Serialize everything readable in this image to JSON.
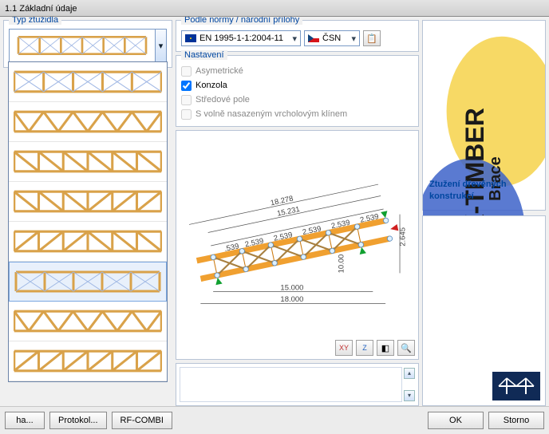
{
  "window": {
    "title": "1.1 Základní údaje"
  },
  "left": {
    "label": "Typ ztužidla"
  },
  "norm": {
    "label": "Podle normy / národní přílohy",
    "standard": "EN 1995-1-1:2004-11",
    "annex": "ČSN"
  },
  "settings": {
    "label": "Nastavení",
    "items": [
      {
        "label": "Asymetrické",
        "checked": false,
        "enabled": false
      },
      {
        "label": "Konzola",
        "checked": true,
        "enabled": true
      },
      {
        "label": "Středové pole",
        "checked": false,
        "enabled": false
      },
      {
        "label": "S volně nasazeným vrcholovým klínem",
        "checked": false,
        "enabled": false
      }
    ]
  },
  "diagram": {
    "dims": {
      "total_top": "18.278",
      "inner_top": "15.231",
      "seg_a": ".539",
      "seg": "2.539",
      "height": "2.645",
      "h_mid": "10.00",
      "bottom_inner": "15.000",
      "bottom_total": "18.000"
    },
    "toolbar": [
      "XY",
      "Z",
      "iso-icon",
      "zoom-icon"
    ]
  },
  "brand": {
    "line1": "RX-TIMBER",
    "line2": "Brace",
    "caption": "Ztužení dřevěných konstrukcí"
  },
  "footer": {
    "btn_ha": "ha...",
    "btn_protokol": "Protokol...",
    "btn_rfcombi": "RF-COMBI",
    "btn_ok": "OK",
    "btn_storno": "Storno"
  }
}
